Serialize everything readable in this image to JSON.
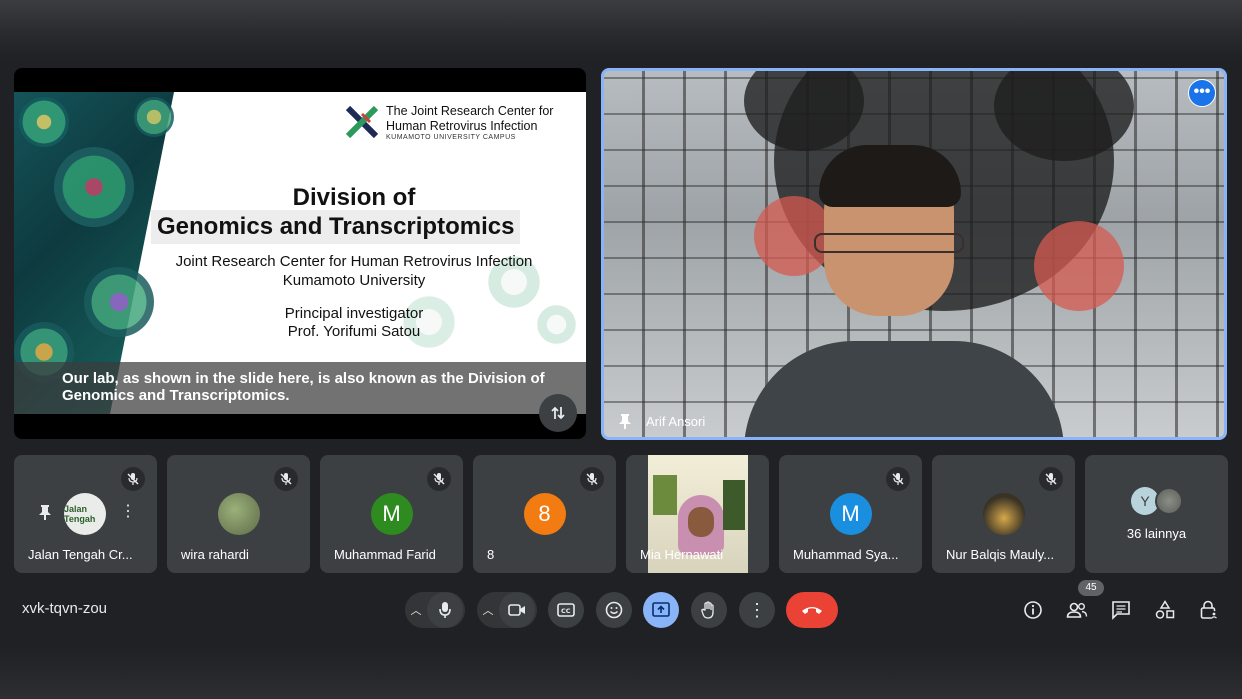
{
  "slide": {
    "logo_line1": "The Joint Research Center for",
    "logo_line2": "Human Retrovirus Infection",
    "logo_sub": "KUMAMOTO UNIVERSITY CAMPUS",
    "title_line1": "Division of",
    "title_line2": "Genomics and Transcriptomics",
    "line1": "Joint Research Center for Human Retrovirus Infection",
    "line2": "Kumamoto University",
    "line3": "Principal investigator",
    "line4": "Prof. Yorifumi Satou",
    "caption": "Our lab, as shown in the slide here, is also known as the Division of Genomics and Transcriptomics."
  },
  "speaker": {
    "name": "Arif Ansori"
  },
  "participants": [
    {
      "name": "Jalan Tengah Cr...",
      "avatar_text": "Jalan Tengah",
      "avatar_color": "#e9ece9",
      "muted": true
    },
    {
      "name": "wira rahardi",
      "avatar_text": "",
      "avatar_color": "#7d8a63",
      "muted": true
    },
    {
      "name": "Muhammad Farid",
      "avatar_text": "M",
      "avatar_color": "#2e8b1f",
      "muted": true
    },
    {
      "name": "8",
      "avatar_text": "8",
      "avatar_color": "#f37c12",
      "muted": true
    },
    {
      "name": "Mia Hernawati",
      "avatar_text": "",
      "avatar_color": "#e6e2d0",
      "muted": false
    },
    {
      "name": "Muhammad Sya...",
      "avatar_text": "M",
      "avatar_color": "#1a8fe0",
      "muted": true
    },
    {
      "name": "Nur Balqis Mauly...",
      "avatar_text": "",
      "avatar_color": "#4d4632",
      "muted": true
    },
    {
      "name": "36 lainnya",
      "avatar_text": "Y",
      "avatar_color": "#b8d3dc",
      "muted": false
    }
  ],
  "toolbar": {
    "meeting_code": "xvk-tqvn-zou",
    "people_count": "45"
  }
}
